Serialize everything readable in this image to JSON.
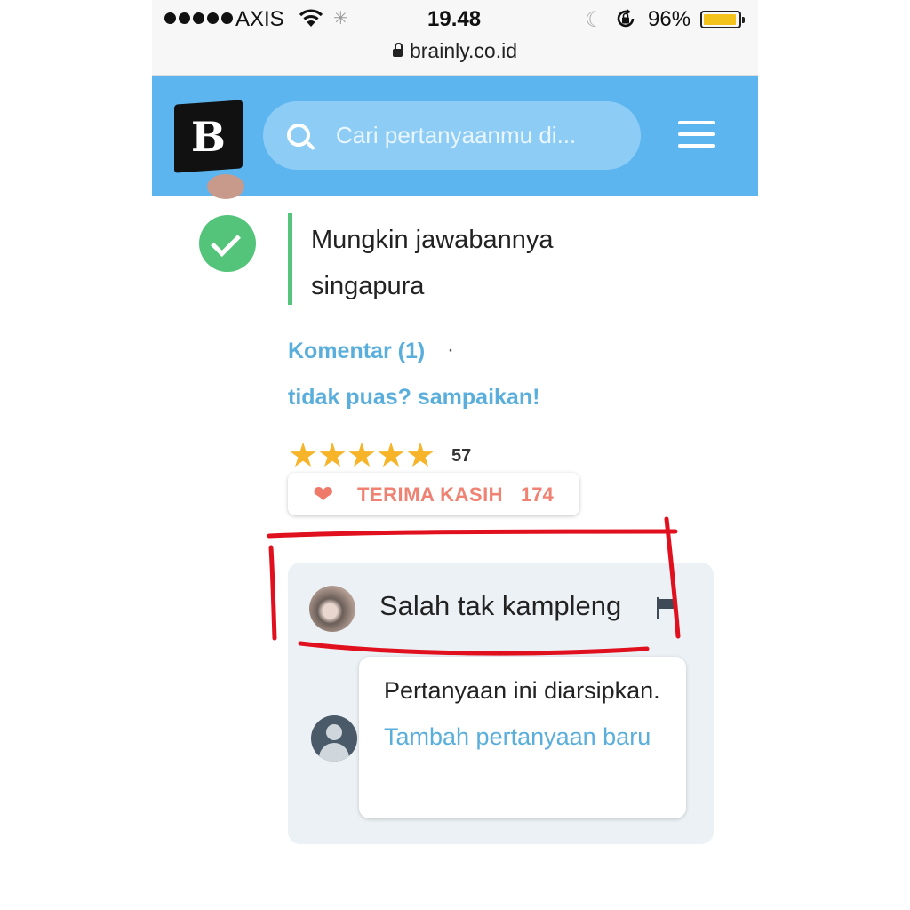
{
  "status_bar": {
    "carrier": "AXIS",
    "time": "19.48",
    "battery_percent": "96%",
    "battery_level": 0.96,
    "url": "brainly.co.id",
    "icons": [
      "signal-dots-icon",
      "wifi-icon",
      "loading-spinner-icon",
      "moon-icon",
      "rotation-lock-icon",
      "battery-icon",
      "lock-icon"
    ]
  },
  "header": {
    "logo_letter": "B",
    "search_placeholder": "Cari pertanyaanmu di...",
    "colors": {
      "header_bg": "#5cb5ef",
      "search_bg": "#8dccf5"
    }
  },
  "answer": {
    "text": "Mungkin jawabannya singapura",
    "comments_link": "Komentar (1)",
    "separator": "·",
    "dissatisfied_link": "tidak puas? sampaikan!",
    "rating_stars": 5,
    "rating_count": "57",
    "thanks_label": "TERIMA KASIH",
    "thanks_count": "174",
    "colors": {
      "verified": "#53c47a",
      "link": "#5aaedc",
      "star": "#f7b428",
      "thanks": "#ef8272"
    }
  },
  "comments": {
    "first_comment": "Salah tak kampleng",
    "archived_notice_prefix": "Pertanyaan ini diarsipkan. ",
    "archived_notice_link": "Tambah pertanyaan baru"
  },
  "annotation": {
    "color": "#e0101e"
  }
}
